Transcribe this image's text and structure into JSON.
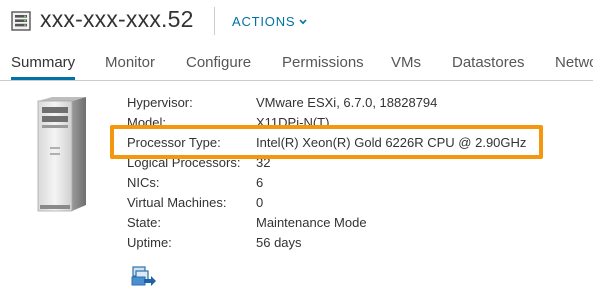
{
  "header": {
    "icon": "host-icon",
    "title": "xxx-xxx-xxx.52",
    "actions_label": "ACTIONS",
    "actions_icon": "chevron-down-icon",
    "accent_color": "#0072a3"
  },
  "tabs": [
    {
      "label": "Summary",
      "active": true
    },
    {
      "label": "Monitor",
      "active": false
    },
    {
      "label": "Configure",
      "active": false
    },
    {
      "label": "Permissions",
      "active": false
    },
    {
      "label": "VMs",
      "active": false
    },
    {
      "label": "Datastores",
      "active": false
    },
    {
      "label": "Networks",
      "active": false
    }
  ],
  "summary": {
    "server_image": "server-tower-icon",
    "properties": [
      {
        "label": "Hypervisor:",
        "value": "VMware ESXi, 6.7.0, 18828794"
      },
      {
        "label": "Model:",
        "value": "X11DPi-N(T)"
      },
      {
        "label": "Processor Type:",
        "value": "Intel(R) Xeon(R) Gold 6226R CPU @ 2.90GHz"
      },
      {
        "label": "Logical Processors:",
        "value": "32"
      },
      {
        "label": "NICs:",
        "value": "6"
      },
      {
        "label": "Virtual Machines:",
        "value": "0"
      },
      {
        "label": "State:",
        "value": "Maintenance Mode"
      },
      {
        "label": "Uptime:",
        "value": "56 days"
      }
    ],
    "highlight_color": "#f5960f",
    "action_icon": "vm-migrate-icon"
  }
}
